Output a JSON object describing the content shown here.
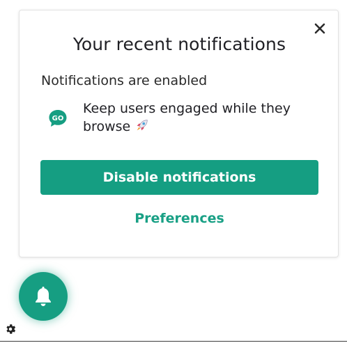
{
  "panel": {
    "title": "Your recent notifications",
    "status_text": "Notifications are enabled",
    "message": {
      "icon": "go-chat-bubble-icon",
      "text": "Keep users engaged while they browse",
      "emoji": "rocket-icon"
    },
    "primary_button_label": "Disable notifications",
    "secondary_link_label": "Preferences",
    "close_icon": "close-icon"
  },
  "launcher": {
    "icon": "bell-icon"
  },
  "settings": {
    "icon": "gear-icon"
  },
  "colors": {
    "accent": "#159e82",
    "text": "#1f1f24",
    "muted_text": "#2a2a2a",
    "card_border": "#e2e2e2",
    "background": "#ffffff"
  }
}
